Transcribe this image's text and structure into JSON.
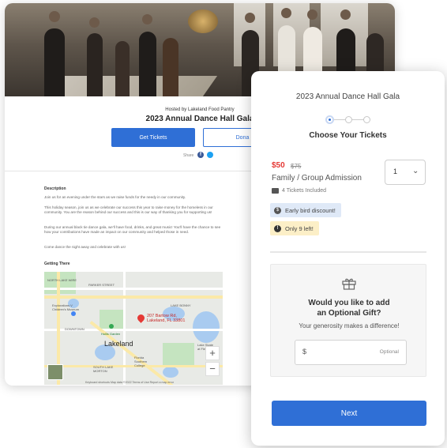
{
  "event_page": {
    "hosted_by": "Hosted by Lakeland Food Pantry",
    "title": "2023 Annual Dance Hall Gala",
    "get_tickets_label": "Get Tickets",
    "donate_label": "Dona",
    "share_label": "Share",
    "description_heading": "Description",
    "description_paragraphs": [
      "Join us for an evening under the stars as we raise funds for the needy in our community.",
      "This holiday season, join us as we celebrate our success this year to raise money for the homeless in our community. You are the reason behind our success and this is our way of thanking you for supporting us!",
      "During our annual black tie dance gala, we'll have food, drinks, and great music! You'll have the chance to see how your contributions have made an impact on our community and helped those in need.",
      "Come dance the night away and celebrate with us!"
    ],
    "getting_there_heading": "Getting There",
    "map": {
      "labels": {
        "north_lake_wire": "NORTH\nLAKE WIRE",
        "parker_street": "PARKER STREET",
        "lake_bonny": "LAKE BONNY",
        "explorations": "Explorations V\nChildren's Museum",
        "downtown": "DOWNTOWN",
        "hollis_garden": "Hollis Garden",
        "lakeland": "Lakeland",
        "south_lake_morton": "SOUTH LAKE\nMORTON",
        "florida_southern": "Florida\nSouthern\nCollege",
        "lake_skate": "Lake Skate\nat Fletcher P",
        "address": "207 Bartow Rd,\nLakeland, FL 33801",
        "zoom_in": "+",
        "zoom_out": "−",
        "footer": "Keyboard shortcuts   Map data ©2022   Terms of Use   Report a map error"
      }
    }
  },
  "ticket_modal": {
    "title": "2023 Annual Dance Hall Gala",
    "step_heading": "Choose Your Tickets",
    "price": "$50",
    "original_price": "$75",
    "ticket_name": "Family / Group Admission",
    "included_text": "4 Tickets Included",
    "quantity": "1",
    "quantity_chevron": "⌄",
    "early_bird_text": "Early bird discount!",
    "early_bird_icon_char": "$",
    "only_left_text": "Only 9 left!",
    "only_left_icon_char": "!",
    "gift_heading_line1": "Would you like to add",
    "gift_heading_line2": "an Optional Gift?",
    "gift_subtext": "Your generosity makes a difference!",
    "gift_currency": "$",
    "gift_placeholder": "Optional",
    "next_label": "Next"
  },
  "colors": {
    "primary": "#2f6fd6",
    "price_red": "#e53935",
    "early_bird_bg": "#dfe9f7",
    "only_left_bg": "#fcefc7"
  }
}
